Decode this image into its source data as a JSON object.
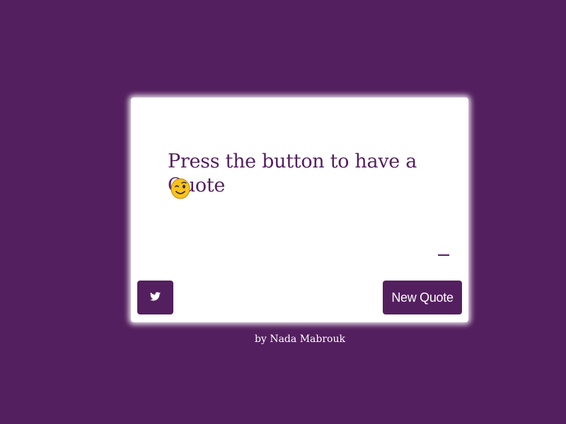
{
  "card": {
    "quote": "Press the button to have a Quote",
    "emoji_icon": "winking-face-icon",
    "author": "—"
  },
  "buttons": {
    "twitter_icon": "twitter-bird-icon",
    "new_quote_label": "New Quote"
  },
  "footer": {
    "credit": "by Nada Mabrouk"
  },
  "colors": {
    "background": "#541f5f",
    "card": "#ffffff",
    "accent": "#541f5f"
  }
}
